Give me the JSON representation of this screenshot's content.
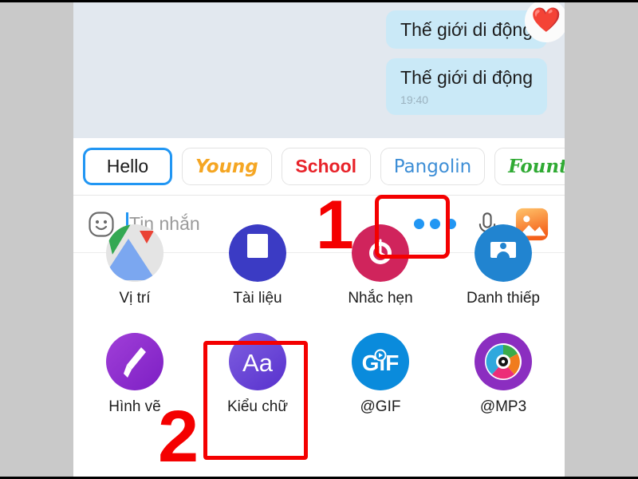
{
  "chat": {
    "messages": [
      {
        "text": "Thế giới di động",
        "time": "",
        "reaction": "❤️"
      },
      {
        "text": "Thế giới di động",
        "time": "19:40",
        "reaction": ""
      }
    ]
  },
  "font_strip": {
    "chips": [
      {
        "label": "Hello",
        "style": "plain",
        "color": "#1c1c1c",
        "selected": true
      },
      {
        "label": "Young",
        "style": "young",
        "color": "#f5a623",
        "selected": false
      },
      {
        "label": "School",
        "style": "school",
        "color": "#e8232a",
        "selected": false
      },
      {
        "label": "Pangolin",
        "style": "pangolin",
        "color": "#3d8ed6",
        "selected": false
      },
      {
        "label": "Fountain",
        "style": "fountain",
        "color": "#2faa33",
        "selected": false
      }
    ]
  },
  "input_bar": {
    "emoji_icon": "smiley-icon",
    "placeholder": "Tin nhắn",
    "value": "",
    "more_icon": "three-dots-icon",
    "mic_icon": "microphone-icon",
    "gallery_icon": "image-gallery-icon"
  },
  "app_grid": {
    "row1": [
      {
        "label": "Vị trí",
        "icon": "location-icon"
      },
      {
        "label": "Tài liệu",
        "icon": "document-icon"
      },
      {
        "label": "Nhắc hẹn",
        "icon": "reminder-clock-icon"
      },
      {
        "label": "Danh thiếp",
        "icon": "contact-card-icon"
      }
    ],
    "row2": [
      {
        "label": "Hình vẽ",
        "icon": "paintbrush-icon"
      },
      {
        "label": "Kiểu chữ",
        "icon": "font-style-aa-icon"
      },
      {
        "label": "@GIF",
        "icon": "gif-icon"
      },
      {
        "label": "@MP3",
        "icon": "mp3-disc-icon"
      }
    ]
  },
  "annotations": {
    "step1": "1",
    "step2": "2",
    "highlight_color": "#f40000"
  }
}
